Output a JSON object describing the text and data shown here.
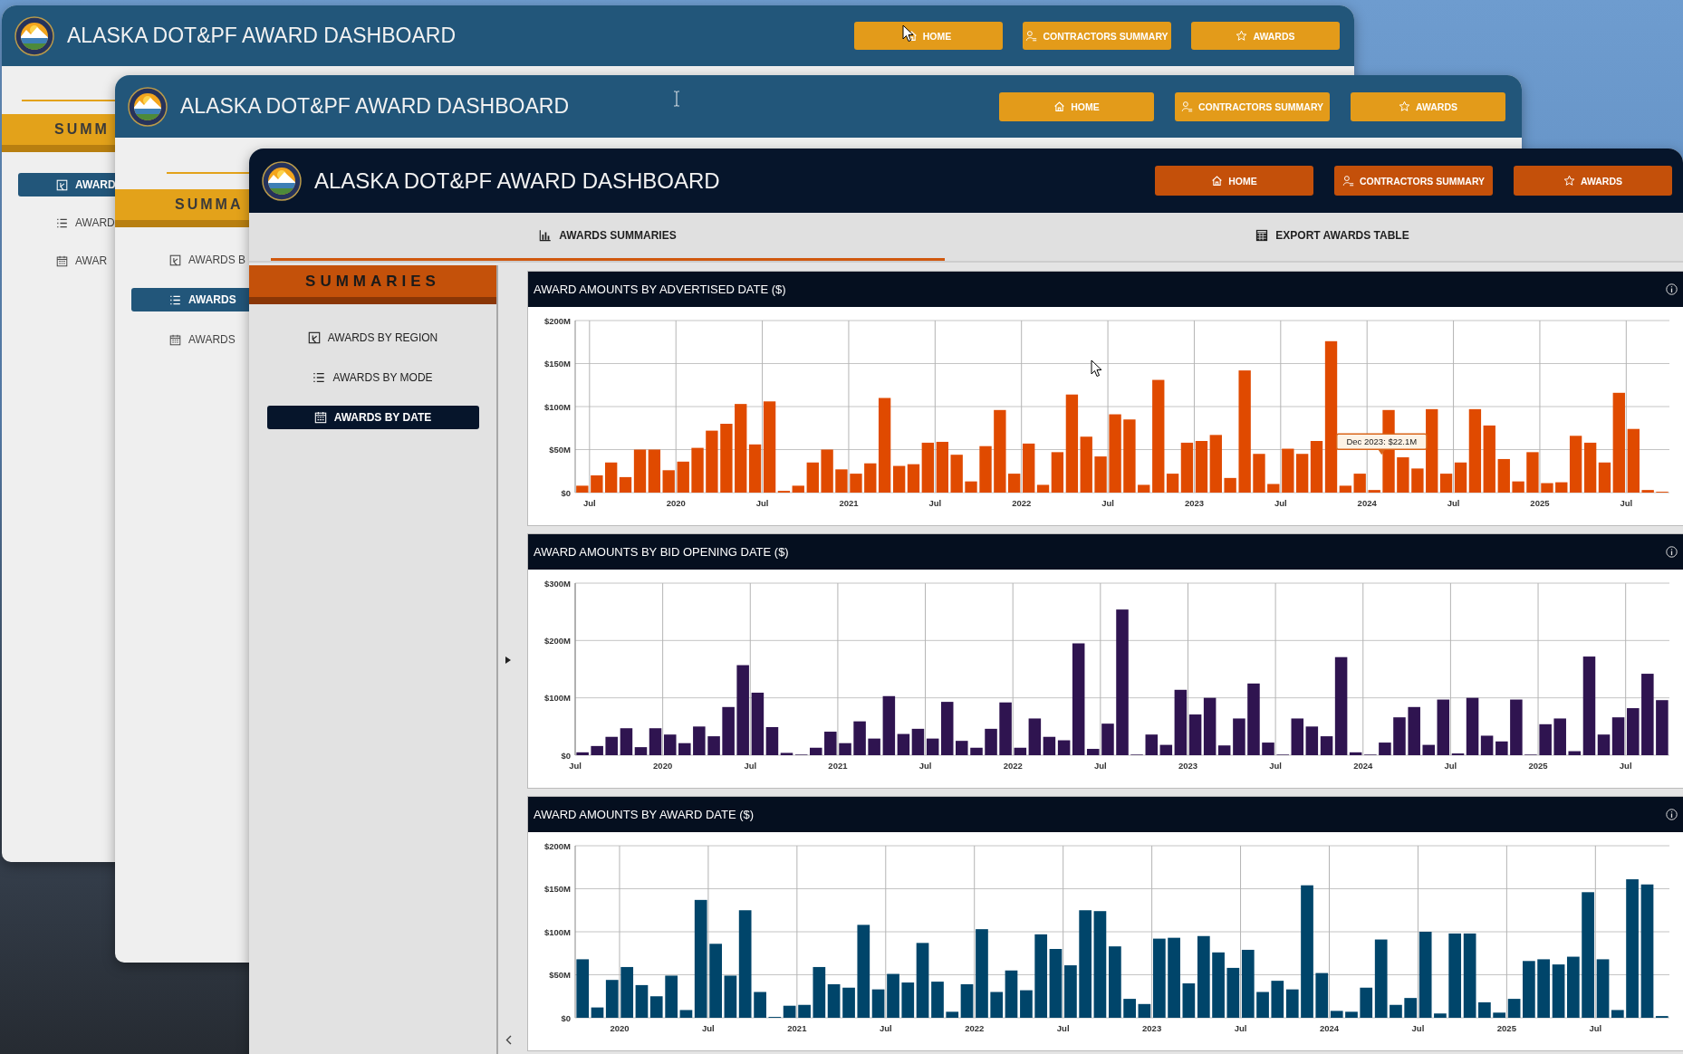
{
  "windows": [
    {
      "kind": "classic",
      "title": "ALASKA DOT&PF AWARD DASHBOARD",
      "nav_buttons": [
        {
          "kind": "home",
          "label": "HOME"
        },
        {
          "kind": "contractors",
          "label": "CONTRACTORS SUMMARY"
        },
        {
          "kind": "awards",
          "label": "AWARDS"
        }
      ],
      "sidebar": {
        "heading": "SUMM",
        "items": [
          {
            "kind": "region",
            "label": "AWARD",
            "selected": true
          },
          {
            "kind": "mode",
            "label": "AWARD",
            "selected": false
          },
          {
            "kind": "date",
            "label": "AWAR",
            "selected": false
          }
        ]
      }
    },
    {
      "kind": "classic",
      "title": "ALASKA DOT&PF AWARD DASHBOARD",
      "nav_buttons": [
        {
          "kind": "home",
          "label": "HOME"
        },
        {
          "kind": "contractors",
          "label": "CONTRACTORS SUMMARY"
        },
        {
          "kind": "awards",
          "label": "AWARDS"
        }
      ],
      "sidebar": {
        "heading": "SUMMA",
        "items": [
          {
            "kind": "region",
            "label": "AWARDS B",
            "selected": false
          },
          {
            "kind": "mode",
            "label": "AWARDS",
            "selected": true
          },
          {
            "kind": "date",
            "label": "AWARDS",
            "selected": false
          }
        ]
      }
    },
    {
      "kind": "dark",
      "title": "ALASKA DOT&PF AWARD DASHBOARD",
      "nav_buttons": [
        {
          "kind": "home",
          "label": "HOME"
        },
        {
          "kind": "contractors",
          "label": "CONTRACTORS SUMMARY"
        },
        {
          "kind": "awards",
          "label": "AWARDS"
        }
      ],
      "tabs": [
        {
          "kind": "chart",
          "label": "AWARDS SUMMARIES",
          "selected": true
        },
        {
          "kind": "table",
          "label": "EXPORT AWARDS TABLE",
          "selected": false
        }
      ],
      "sidebar": {
        "heading": "SUMMARIES",
        "items": [
          {
            "kind": "region",
            "label": "AWARDS BY REGION",
            "selected": false
          },
          {
            "kind": "mode",
            "label": "AWARDS BY MODE",
            "selected": false
          },
          {
            "kind": "date",
            "label": "AWARDS BY DATE",
            "selected": true
          }
        ]
      },
      "panels": [
        {
          "chart_data": {
            "type": "bar",
            "title": "AWARD AMOUNTS BY ADVERTISED DATE ($)",
            "grid": true,
            "x": [
              2019.458,
              2019.542,
              2019.625,
              2019.708,
              2019.792,
              2019.875,
              2019.958,
              2020.042,
              2020.125,
              2020.208,
              2020.292,
              2020.375,
              2020.458,
              2020.542,
              2020.625,
              2020.708,
              2020.792,
              2020.875,
              2020.958,
              2021.042,
              2021.125,
              2021.208,
              2021.292,
              2021.375,
              2021.458,
              2021.542,
              2021.625,
              2021.708,
              2021.792,
              2021.875,
              2021.958,
              2022.042,
              2022.125,
              2022.208,
              2022.292,
              2022.375,
              2022.458,
              2022.542,
              2022.625,
              2022.708,
              2022.792,
              2022.875,
              2022.958,
              2023.042,
              2023.125,
              2023.208,
              2023.292,
              2023.375,
              2023.458,
              2023.542,
              2023.625,
              2023.708,
              2023.792,
              2023.875,
              2023.958,
              2024.042,
              2024.125,
              2024.208,
              2024.292,
              2024.375,
              2024.458,
              2024.542,
              2024.625,
              2024.708,
              2024.792,
              2024.875,
              2024.958,
              2025.042,
              2025.125,
              2025.208,
              2025.292,
              2025.375,
              2025.458,
              2025.542,
              2025.625,
              2025.708
            ],
            "series": [
              {
                "color": "#e04a00",
                "values": [
                  8,
                  20,
                  35,
                  18,
                  50,
                  50,
                  26,
                  36,
                  52,
                  72,
                  80,
                  103,
                  56,
                  106,
                  2,
                  8,
                  35,
                  50,
                  27,
                  22,
                  34,
                  110,
                  31,
                  33,
                  58,
                  59,
                  44,
                  13,
                  54,
                  96,
                  22,
                  57,
                  9,
                  47,
                  114,
                  65,
                  42,
                  91,
                  85,
                  9,
                  131,
                  22,
                  58,
                  60,
                  67,
                  17,
                  142,
                  45,
                  10,
                  51,
                  45,
                  60,
                  176,
                  8,
                  22,
                  3,
                  96,
                  41,
                  28,
                  97,
                  22,
                  35,
                  97,
                  78,
                  39,
                  13,
                  47,
                  11,
                  12,
                  66,
                  58,
                  35,
                  116,
                  74,
                  3,
                  1
                ]
              }
            ],
            "xlim": [
              2019.417,
              2025.75
            ],
            "ylim": [
              0,
              200
            ],
            "yticks": [
              {
                "value": 0,
                "label": "$0"
              },
              {
                "value": 50,
                "label": "$50M"
              },
              {
                "value": 100,
                "label": "$100M"
              },
              {
                "value": 150,
                "label": "$150M"
              },
              {
                "value": 200,
                "label": "$200M"
              }
            ],
            "xticks": [
              {
                "value": 2019.5,
                "label": "Jul"
              },
              2020,
              {
                "value": 2020.5,
                "label": "Jul"
              },
              2021,
              {
                "value": 2021.5,
                "label": "Jul"
              },
              2022,
              {
                "value": 2022.5,
                "label": "Jul"
              },
              2023,
              {
                "value": 2023.5,
                "label": "Jul"
              },
              2024,
              {
                "value": 2024.5,
                "label": "Jul"
              },
              2025,
              {
                "value": 2025.5,
                "label": "Jul"
              }
            ],
            "annotations": [
              "Dec 2023: $22.1M"
            ]
          }
        },
        {
          "chart_data": {
            "type": "bar",
            "title": "AWARD AMOUNTS BY BID OPENING DATE ($)",
            "grid": true,
            "x": [
              2019.542,
              2019.625,
              2019.708,
              2019.792,
              2019.875,
              2019.958,
              2020.042,
              2020.125,
              2020.208,
              2020.292,
              2020.375,
              2020.458,
              2020.542,
              2020.625,
              2020.708,
              2020.792,
              2020.875,
              2020.958,
              2021.042,
              2021.125,
              2021.208,
              2021.292,
              2021.375,
              2021.458,
              2021.542,
              2021.625,
              2021.708,
              2021.792,
              2021.875,
              2021.958,
              2022.042,
              2022.125,
              2022.208,
              2022.292,
              2022.375,
              2022.458,
              2022.542,
              2022.625,
              2022.708,
              2022.792,
              2022.875,
              2022.958,
              2023.042,
              2023.125,
              2023.208,
              2023.292,
              2023.375,
              2023.458,
              2023.542,
              2023.625,
              2023.708,
              2023.792,
              2023.875,
              2023.958,
              2024.042,
              2024.125,
              2024.208,
              2024.292,
              2024.375,
              2024.458,
              2024.542,
              2024.625,
              2024.708,
              2024.792,
              2024.875,
              2024.958,
              2025.042,
              2025.125,
              2025.208,
              2025.292,
              2025.375,
              2025.458,
              2025.542,
              2025.625,
              2025.708
            ],
            "series": [
              {
                "color": "#2f1450",
                "values": [
                  5,
                  16,
                  32,
                  47,
                  14,
                  47,
                  36,
                  21,
                  50,
                  33,
                  84,
                  157,
                  109,
                  49,
                  4,
                  1,
                  13,
                  41,
                  21,
                  59,
                  29,
                  103,
                  37,
                  46,
                  29,
                  93,
                  25,
                  13,
                  46,
                  92,
                  13,
                  64,
                  32,
                  26,
                  195,
                  11,
                  55,
                  254,
                  1,
                  36,
                  18,
                  114,
                  71,
                  100,
                  17,
                  64,
                  125,
                  22,
                  1,
                  64,
                  50,
                  33,
                  171,
                  5,
                  1,
                  22,
                  66,
                  84,
                  18,
                  97,
                  3,
                  100,
                  34,
                  24,
                  97,
                  1,
                  54,
                  64,
                  7,
                  172,
                  36,
                  66,
                  82,
                  142,
                  96
                ]
              }
            ],
            "xlim": [
              2019.5,
              2025.75
            ],
            "ylim": [
              0,
              300
            ],
            "yticks": [
              {
                "value": 0,
                "label": "$0"
              },
              {
                "value": 100,
                "label": "$100M"
              },
              {
                "value": 200,
                "label": "$200M"
              },
              {
                "value": 300,
                "label": "$300M"
              }
            ],
            "xticks": [
              {
                "value": 2019.5,
                "label": "Jul"
              },
              2020,
              {
                "value": 2020.5,
                "label": "Jul"
              },
              2021,
              {
                "value": 2021.5,
                "label": "Jul"
              },
              2022,
              {
                "value": 2022.5,
                "label": "Jul"
              },
              2023,
              {
                "value": 2023.5,
                "label": "Jul"
              },
              2024,
              {
                "value": 2024.5,
                "label": "Jul"
              },
              2025,
              {
                "value": 2025.5,
                "label": "Jul"
              }
            ]
          }
        },
        {
          "chart_data": {
            "type": "bar",
            "title": "AWARD AMOUNTS BY AWARD DATE ($)",
            "grid": true,
            "x": [
              2019.792,
              2019.875,
              2019.958,
              2020.042,
              2020.125,
              2020.208,
              2020.292,
              2020.375,
              2020.458,
              2020.542,
              2020.625,
              2020.708,
              2020.792,
              2020.875,
              2020.958,
              2021.042,
              2021.125,
              2021.208,
              2021.292,
              2021.375,
              2021.458,
              2021.542,
              2021.625,
              2021.708,
              2021.792,
              2021.875,
              2021.958,
              2022.042,
              2022.125,
              2022.208,
              2022.292,
              2022.375,
              2022.458,
              2022.542,
              2022.625,
              2022.708,
              2022.792,
              2022.875,
              2022.958,
              2023.042,
              2023.125,
              2023.208,
              2023.292,
              2023.375,
              2023.458,
              2023.542,
              2023.625,
              2023.708,
              2023.792,
              2023.875,
              2023.958,
              2024.042,
              2024.125,
              2024.208,
              2024.292,
              2024.375,
              2024.458,
              2024.542,
              2024.625,
              2024.708,
              2024.792,
              2024.875,
              2024.958,
              2025.042,
              2025.125,
              2025.208,
              2025.292,
              2025.375,
              2025.458,
              2025.542,
              2025.625,
              2025.708,
              2025.792,
              2025.875
            ],
            "series": [
              {
                "color": "#00456a",
                "values": [
                  68,
                  12,
                  44,
                  59,
                  38,
                  25,
                  49,
                  9,
                  137,
                  86,
                  49,
                  125,
                  30,
                  1,
                  14,
                  15,
                  59,
                  39,
                  35,
                  108,
                  33,
                  51,
                  41,
                  87,
                  42,
                  7,
                  39,
                  103,
                  30,
                  55,
                  32,
                  97,
                  80,
                  61,
                  125,
                  124,
                  83,
                  22,
                  16,
                  92,
                  93,
                  40,
                  95,
                  76,
                  58,
                  79,
                  30,
                  43,
                  33,
                  154,
                  52,
                  8,
                  7,
                  35,
                  91,
                  15,
                  23,
                  100,
                  5,
                  98,
                  98,
                  18,
                  6,
                  22,
                  66,
                  68,
                  62,
                  71,
                  146,
                  68,
                  9,
                  161,
                  155,
                  2
                ]
              }
            ],
            "xlim": [
              2019.75,
              2025.917
            ],
            "ylim": [
              0,
              200
            ],
            "yticks": [
              {
                "value": 0,
                "label": "$0"
              },
              {
                "value": 50,
                "label": "$50M"
              },
              {
                "value": 100,
                "label": "$100M"
              },
              {
                "value": 150,
                "label": "$150M"
              },
              {
                "value": 200,
                "label": "$200M"
              }
            ],
            "xticks": [
              2020,
              {
                "value": 2020.5,
                "label": "Jul"
              },
              2021,
              {
                "value": 2021.5,
                "label": "Jul"
              },
              2022,
              {
                "value": 2022.5,
                "label": "Jul"
              },
              2023,
              {
                "value": 2023.5,
                "label": "Jul"
              },
              2024,
              {
                "value": 2024.5,
                "label": "Jul"
              },
              2025,
              {
                "value": 2025.5,
                "label": "Jul"
              }
            ]
          }
        }
      ]
    }
  ]
}
